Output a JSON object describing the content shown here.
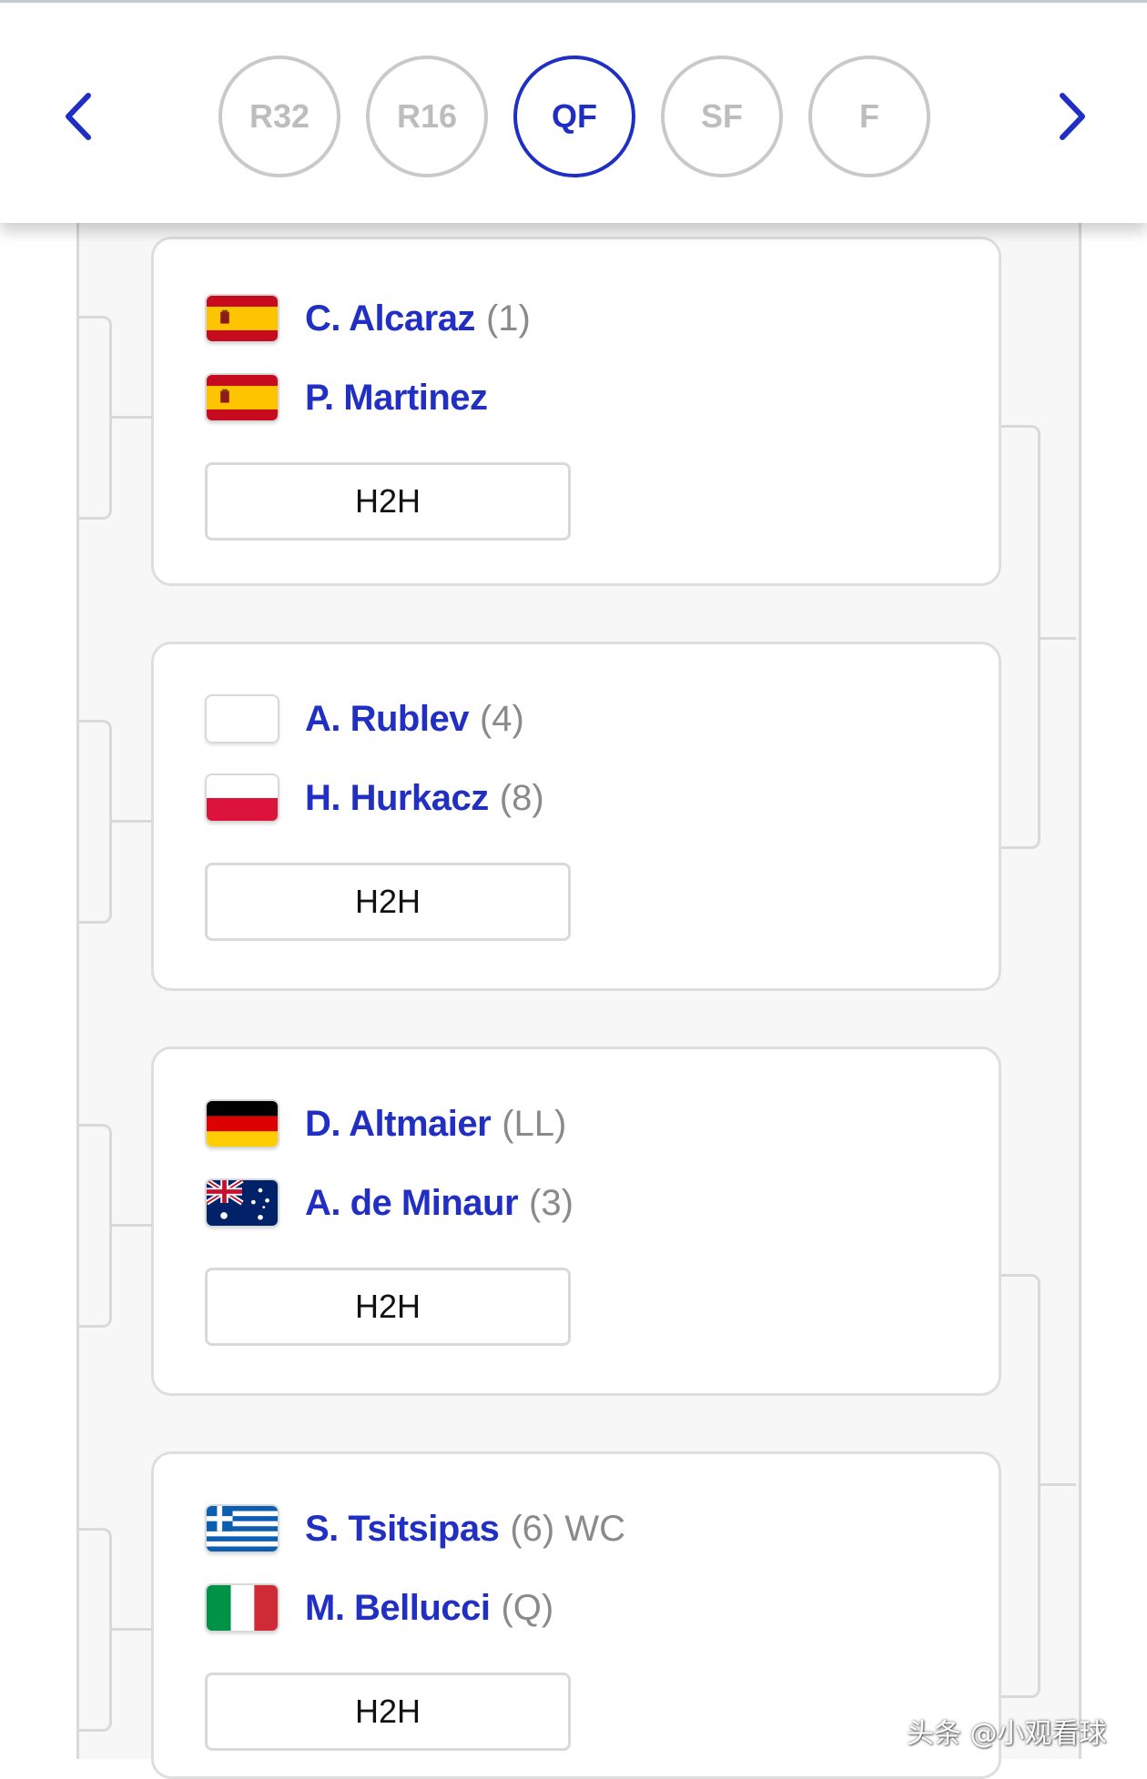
{
  "rounds": {
    "prev_icon": "chevron-left-icon",
    "next_icon": "chevron-right-icon",
    "items": [
      {
        "label": "R32"
      },
      {
        "label": "R16"
      },
      {
        "label": "QF",
        "active": true
      },
      {
        "label": "SF"
      },
      {
        "label": "F"
      }
    ],
    "active_color": "#1f2ec4",
    "inactive_color": "#c9c9c9"
  },
  "matches": [
    {
      "players": [
        {
          "name": "C. Alcaraz",
          "seed": "(1)",
          "flag": "spain-flag-icon"
        },
        {
          "name": "P. Martinez",
          "seed": "",
          "flag": "spain-flag-icon"
        }
      ],
      "h2h_label": "H2H"
    },
    {
      "players": [
        {
          "name": "A. Rublev",
          "seed": "(4)",
          "flag": "blank-flag-icon"
        },
        {
          "name": "H. Hurkacz",
          "seed": "(8)",
          "flag": "poland-flag-icon"
        }
      ],
      "h2h_label": "H2H"
    },
    {
      "players": [
        {
          "name": "D. Altmaier",
          "seed": "(LL)",
          "flag": "germany-flag-icon"
        },
        {
          "name": "A. de Minaur",
          "seed": "(3)",
          "flag": "australia-flag-icon"
        }
      ],
      "h2h_label": "H2H"
    },
    {
      "players": [
        {
          "name": "S. Tsitsipas",
          "seed": "(6) WC",
          "flag": "greece-flag-icon"
        },
        {
          "name": "M. Bellucci",
          "seed": "(Q)",
          "flag": "italy-flag-icon"
        }
      ],
      "h2h_label": "H2H"
    }
  ],
  "colors": {
    "player_name": "#2130c2",
    "seed": "#8a8a8a"
  },
  "watermark": "头条 @小观看球"
}
